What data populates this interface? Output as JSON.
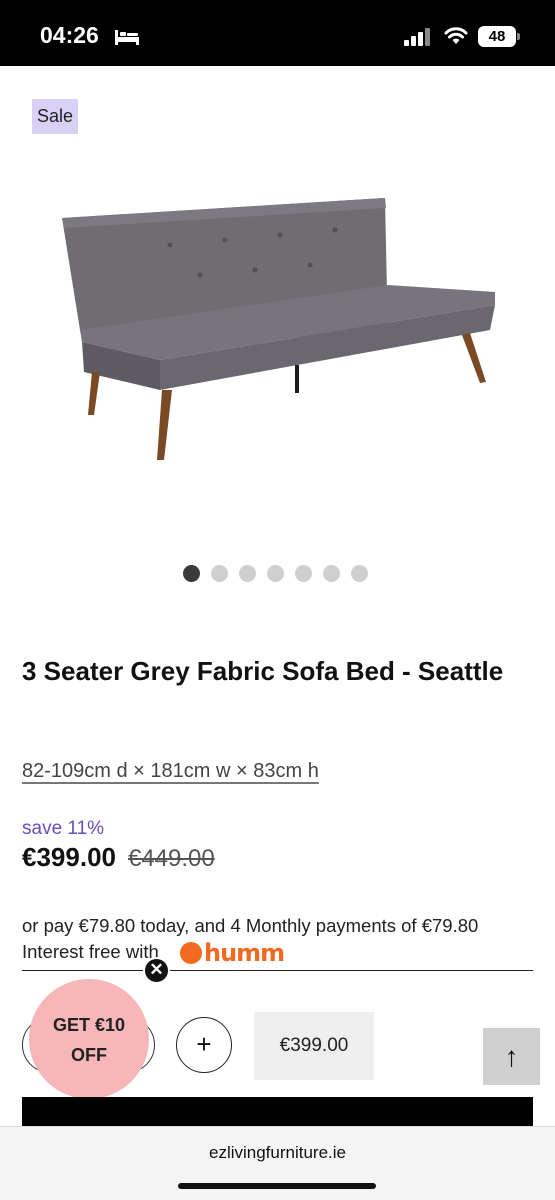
{
  "status_bar": {
    "time": "04:26",
    "battery": "48",
    "icons": [
      "bed-icon",
      "signal-icon",
      "wifi-icon",
      "battery-icon"
    ]
  },
  "product": {
    "badge": "Sale",
    "title": "3 Seater Grey Fabric Sofa Bed - Seattle",
    "dimensions": "82-109cm d × 181cm w × 83cm h",
    "save": "save 11%",
    "price": "€399.00",
    "old_price": "€449.00",
    "carousel": {
      "total": 7,
      "active": 1
    }
  },
  "finance": {
    "pay_text": "or pay €79.80 today, and 4 Monthly payments of €79.80",
    "interest_text": "Interest free with",
    "provider": "humm"
  },
  "cart": {
    "plus_label": "+",
    "price_label": "€399.00"
  },
  "promo": {
    "line1": "GET €10",
    "line2": "OFF",
    "close_label": "✕"
  },
  "scroll_top_label": "↑",
  "browser": {
    "url": "ezlivingfurniture.ie"
  },
  "colors": {
    "accent_purple": "#6a4dbf",
    "badge_bg": "#d8d0f5",
    "promo_bg": "#f7b6b8",
    "humm_orange": "#f26a21"
  }
}
